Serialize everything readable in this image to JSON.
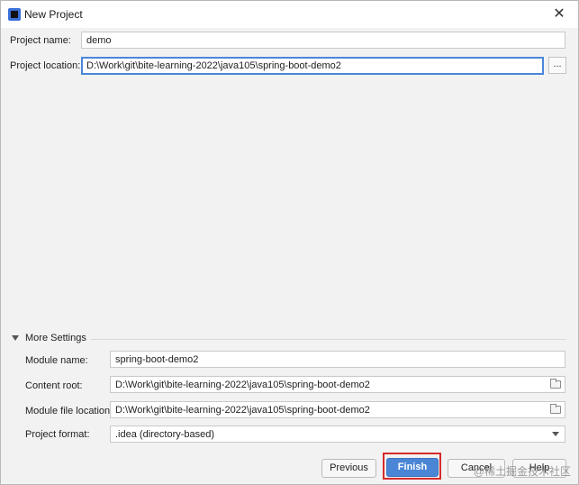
{
  "window": {
    "title": "New Project",
    "close_glyph": "✕"
  },
  "form": {
    "project_name_label": "Project name:",
    "project_name_value": "demo",
    "project_location_label": "Project location:",
    "project_location_value": "D:\\Work\\git\\bite-learning-2022\\java105\\spring-boot-demo2",
    "browse_label": "..."
  },
  "more_settings": {
    "label": "More Settings",
    "module_name_label": "Module name:",
    "module_name_value": "spring-boot-demo2",
    "content_root_label": "Content root:",
    "content_root_value": "D:\\Work\\git\\bite-learning-2022\\java105\\spring-boot-demo2",
    "module_file_location_label": "Module file location:",
    "module_file_location_value": "D:\\Work\\git\\bite-learning-2022\\java105\\spring-boot-demo2",
    "project_format_label": "Project format:",
    "project_format_value": ".idea (directory-based)"
  },
  "buttons": {
    "previous": "Previous",
    "finish": "Finish",
    "cancel": "Cancel",
    "help": "Help"
  },
  "watermark": "@稀土掘金技术社区",
  "colors": {
    "primary_button": "#4b86d6",
    "focus_border": "#4a86d9",
    "highlight_box": "#d62b2b"
  },
  "icons": {
    "app": "intellij-icon",
    "close": "close-icon",
    "expand": "triangle-down-icon",
    "folder": "folder-icon",
    "dropdown": "chevron-down-icon"
  }
}
